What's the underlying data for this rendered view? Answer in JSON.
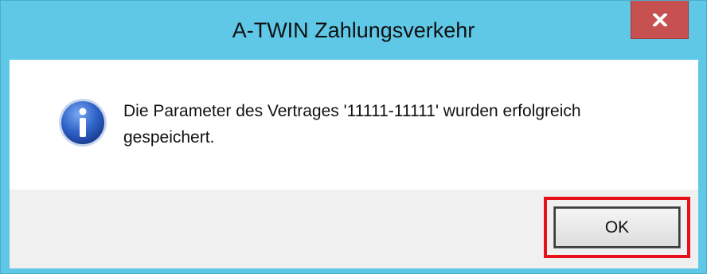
{
  "window": {
    "title": "A-TWIN Zahlungsverkehr",
    "close_icon": "close-icon"
  },
  "dialog": {
    "icon": "info-icon",
    "message_line1": "Die Parameter des Vertrages '11111-11111' wurden erfolgreich",
    "message_line2": "gespeichert."
  },
  "buttons": {
    "ok_label": "OK"
  },
  "colors": {
    "titlebar": "#5ec8e6",
    "close_button": "#c75050",
    "highlight": "#e8101a",
    "footer": "#f0f0f0"
  }
}
